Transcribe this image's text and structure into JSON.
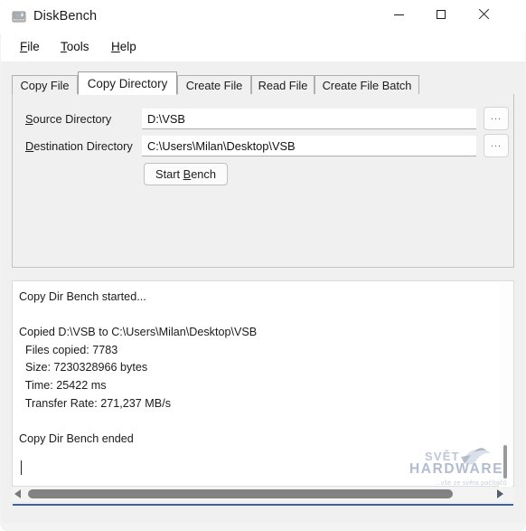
{
  "window": {
    "title": "DiskBench",
    "icon": "disk-drive-icon",
    "controls": {
      "minimize": "minimize-icon",
      "maximize": "maximize-icon",
      "close": "close-icon"
    }
  },
  "menubar": {
    "items": [
      {
        "label": "File",
        "mnemonic": "F"
      },
      {
        "label": "Tools",
        "mnemonic": "T"
      },
      {
        "label": "Help",
        "mnemonic": "H"
      }
    ]
  },
  "tabs": {
    "selected_index": 1,
    "items": [
      {
        "label": "Copy File"
      },
      {
        "label": "Copy Directory"
      },
      {
        "label": "Create File"
      },
      {
        "label": "Read File"
      },
      {
        "label": "Create File Batch"
      }
    ]
  },
  "copy_directory_panel": {
    "source": {
      "label": "Source Directory",
      "mnemonic": "S",
      "value": "D:\\VSB",
      "placeholder": "",
      "browse_label": "..."
    },
    "destination": {
      "label": "Destination Directory",
      "mnemonic": "D",
      "value": "C:\\Users\\Milan\\Desktop\\VSB",
      "placeholder": "",
      "browse_label": "..."
    },
    "start_button": {
      "label": "Start Bench",
      "mnemonic": "B"
    }
  },
  "log": {
    "text": "Copy Dir Bench started...\n\nCopied D:\\VSB to C:\\Users\\Milan\\Desktop\\VSB\n  Files copied: 7783\n  Size: 7230328966 bytes\n  Time: 25422 ms\n  Transfer Rate: 271,237 MB/s\n\nCopy Dir Bench ended",
    "lines": [
      "Copy Dir Bench started...",
      "",
      "Copied D:\\VSB to C:\\Users\\Milan\\Desktop\\VSB",
      "  Files copied: 7783",
      "  Size: 7230328966 bytes",
      "  Time: 25422 ms",
      "  Transfer Rate: 271,237 MB/s",
      "",
      "Copy Dir Bench ended"
    ],
    "results": {
      "files_copied": 7783,
      "size_bytes": 7230328966,
      "time_ms": 25422,
      "transfer_rate_mbs": "271,237"
    },
    "source_path": "D:\\VSB",
    "destination_path": "C:\\Users\\Milan\\Desktop\\VSB"
  },
  "watermark": {
    "brand_top": "SVĚT",
    "brand_bottom": "HARDWARE",
    "tagline": "...vše ze světa počítačů"
  },
  "colors": {
    "accent_blue": "#3d5fa8",
    "client_bg": "#f0f0f0",
    "field_bg": "#ffffff",
    "text": "#1b1b1b",
    "scrollbar_thumb": "#828282"
  }
}
